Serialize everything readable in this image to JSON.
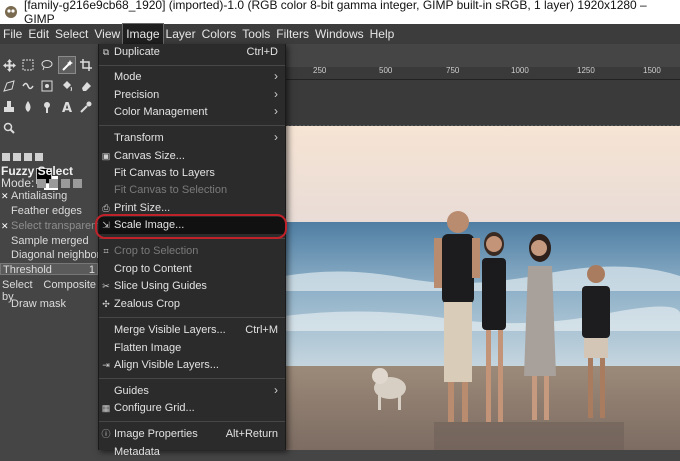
{
  "window": {
    "title": "[family-g216e9cb68_1920] (imported)-1.0 (RGB color 8-bit gamma integer, GIMP built-in sRGB, 1 layer) 1920x1280 – GIMP"
  },
  "menubar": [
    "File",
    "Edit",
    "Select",
    "View",
    "Image",
    "Layer",
    "Colors",
    "Tools",
    "Filters",
    "Windows",
    "Help"
  ],
  "tool_options": {
    "title": "Fuzzy Select",
    "mode_label": "Mode:",
    "antialiasing": "Antialiasing",
    "feather": "Feather edges",
    "transparent": "Select transparent ar",
    "sample_merged": "Sample merged",
    "diagonal": "Diagonal neighbors",
    "threshold_label": "Threshold",
    "threshold_value": "1",
    "selectby_label": "Select by",
    "selectby_value": "Composite",
    "draw_mask": "Draw mask"
  },
  "ruler": [
    "250",
    "500",
    "750",
    "1000",
    "1250",
    "1500"
  ],
  "image_menu": {
    "duplicate": "Duplicate",
    "duplicate_sc": "Ctrl+D",
    "mode": "Mode",
    "precision": "Precision",
    "color_mgmt": "Color Management",
    "transform": "Transform",
    "canvas_size": "Canvas Size...",
    "fit_layers": "Fit Canvas to Layers",
    "fit_selection": "Fit Canvas to Selection",
    "print_size": "Print Size...",
    "scale_image": "Scale Image...",
    "crop_selection": "Crop to Selection",
    "crop_content": "Crop to Content",
    "slice_guides": "Slice Using Guides",
    "zealous_crop": "Zealous Crop",
    "merge_visible": "Merge Visible Layers...",
    "merge_sc": "Ctrl+M",
    "flatten": "Flatten Image",
    "align_visible": "Align Visible Layers...",
    "guides": "Guides",
    "configure_grid": "Configure Grid...",
    "image_properties": "Image Properties",
    "properties_sc": "Alt+Return",
    "metadata": "Metadata"
  },
  "colors": {
    "highlight_ring": "#c0222a",
    "menu_bg": "#2b2b2b",
    "foreground": "#000000",
    "background": "#ffffff"
  }
}
